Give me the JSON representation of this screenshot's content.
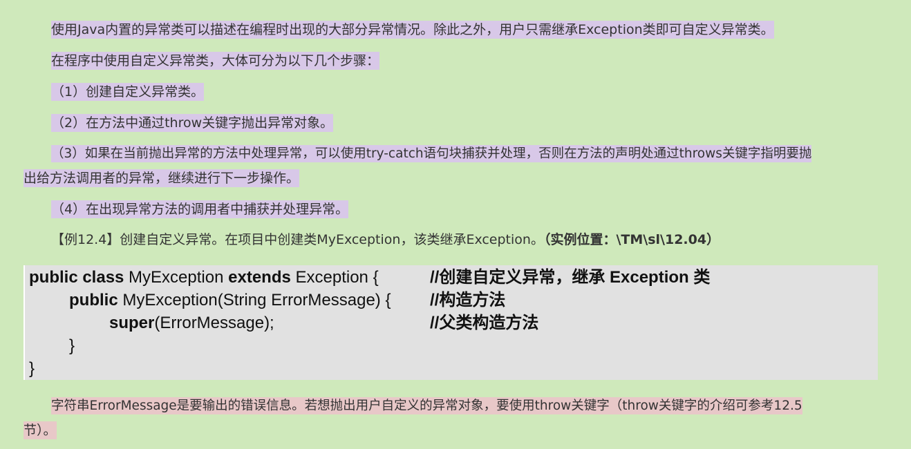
{
  "paragraphs": {
    "p1": "使用Java内置的异常类可以描述在编程时出现的大部分异常情况。除此之外，用户只需继承Exception类即可自定义异常类。",
    "p2": "在程序中使用自定义异常类，大体可分为以下几个步骤：",
    "p3": "（1）创建自定义异常类。",
    "p4": "（2）在方法中通过throw关键字抛出异常对象。",
    "p5_line1": "（3）如果在当前抛出异常的方法中处理异常，可以使用try-catch语句块捕获并处理，否则在方法的声明处通过throws关键字指明要抛",
    "p5_line2": "出给方法调用者的异常，继续进行下一步操作。",
    "p6": "（4）在出现异常方法的调用者中捕获并处理异常。",
    "example_label": "【例12.4】创建自定义异常。在项目中创建类MyException，该类继承Exception。",
    "example_location": "（实例位置：\\TM\\sl\\12.04）",
    "p8_line1": "字符串ErrorMessage是要输出的错误信息。若想抛出用户自定义的异常对象，要使用throw关键字（throw关键字的介绍可参考12.5",
    "p8_line2": "节）。"
  },
  "code": {
    "l1_kw1": "public class",
    "l1_t1": " MyException ",
    "l1_kw2": "extends",
    "l1_t2": " Exception {",
    "l1_comment": "//创建自定义异常，继承 Exception 类",
    "l2_kw": "public",
    "l2_t": " MyException(String ErrorMessage) {",
    "l2_comment": "//构造方法",
    "l3_kw": "super",
    "l3_t": "(ErrorMessage);",
    "l3_comment": "//父类构造方法",
    "l4": "}",
    "l5": "}"
  }
}
